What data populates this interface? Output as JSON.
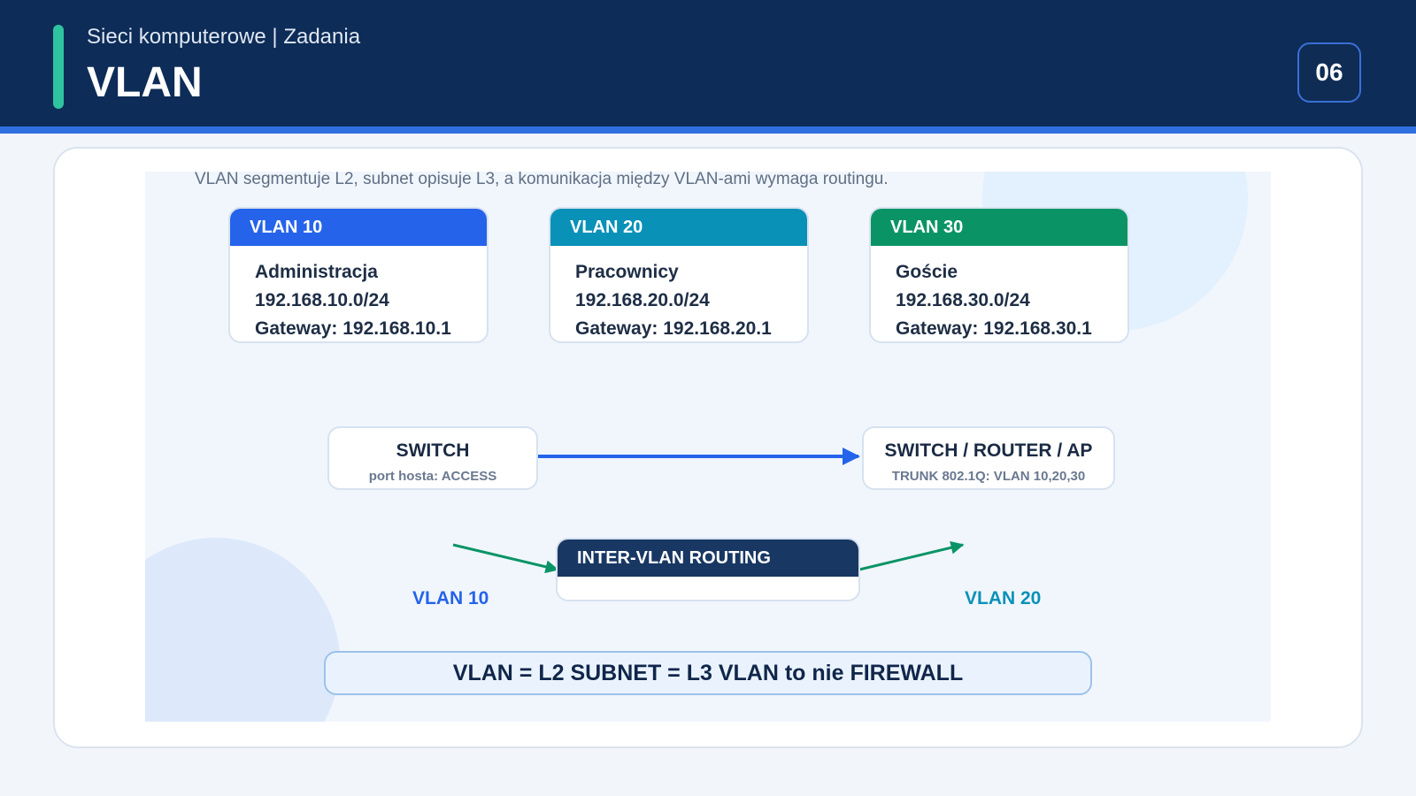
{
  "header": {
    "breadcrumb": "Sieci komputerowe | Zadania",
    "title": "VLAN",
    "slide_number": "06"
  },
  "diagram": {
    "caption": "VLAN segmentuje L2, subnet opisuje L3, a komunikacja między VLAN-ami wymaga routingu.",
    "vlans": [
      {
        "label": "VLAN 10",
        "name": "Administracja",
        "subnet": "192.168.10.0/24",
        "gateway": "Gateway: 192.168.10.1",
        "color": "#2563eb"
      },
      {
        "label": "VLAN 20",
        "name": "Pracownicy",
        "subnet": "192.168.20.0/24",
        "gateway": "Gateway: 192.168.20.1",
        "color": "#0a91b8"
      },
      {
        "label": "VLAN 30",
        "name": "Goście",
        "subnet": "192.168.30.0/24",
        "gateway": "Gateway: 192.168.30.1",
        "color": "#0a9466"
      }
    ],
    "switch_access": {
      "title": "SWITCH",
      "subtitle": "port hosta: ACCESS"
    },
    "switch_trunk": {
      "title": "SWITCH / ROUTER / AP",
      "subtitle": "TRUNK 802.1Q: VLAN 10,20,30"
    },
    "routing": {
      "title": "INTER-VLAN ROUTING"
    },
    "side_labels": {
      "left": {
        "text": "VLAN 10",
        "color": "#2563eb"
      },
      "right": {
        "text": "VLAN 20",
        "color": "#0a91b8"
      }
    },
    "formula": "VLAN = L2 SUBNET = L3 VLAN to nie FIREWALL",
    "colors": {
      "trunk_link": "#2563eb",
      "routing_arrows": "#0a9466"
    }
  }
}
